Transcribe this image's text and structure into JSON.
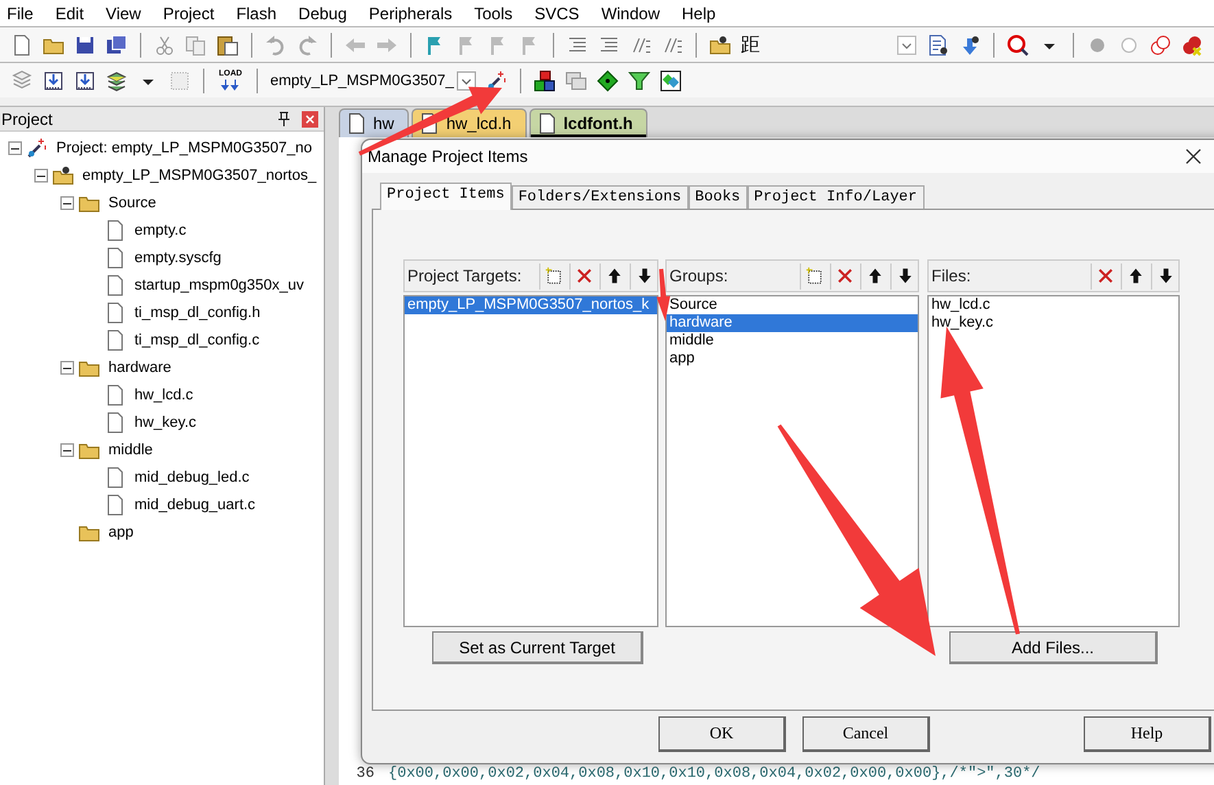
{
  "menu": [
    "File",
    "Edit",
    "View",
    "Project",
    "Flash",
    "Debug",
    "Peripherals",
    "Tools",
    "SVCS",
    "Window",
    "Help"
  ],
  "toolbar_glyph": "距",
  "load_label": "LOAD",
  "target_select": {
    "value": "empty_LP_MSPM0G3507_"
  },
  "project_panel": {
    "title": "Project",
    "tree": [
      {
        "kind": "project",
        "label": "Project: empty_LP_MSPM0G3507_no",
        "expanded": true,
        "children": [
          {
            "kind": "target",
            "label": "empty_LP_MSPM0G3507_nortos_",
            "expanded": true,
            "children": [
              {
                "kind": "group",
                "label": "Source",
                "expanded": true,
                "children": [
                  {
                    "kind": "file",
                    "label": "empty.c"
                  },
                  {
                    "kind": "file",
                    "label": "empty.syscfg"
                  },
                  {
                    "kind": "file",
                    "label": "startup_mspm0g350x_uv"
                  },
                  {
                    "kind": "file",
                    "label": "ti_msp_dl_config.h"
                  },
                  {
                    "kind": "file",
                    "label": "ti_msp_dl_config.c"
                  }
                ]
              },
              {
                "kind": "group",
                "label": "hardware",
                "expanded": true,
                "children": [
                  {
                    "kind": "file",
                    "label": "hw_lcd.c"
                  },
                  {
                    "kind": "file",
                    "label": "hw_key.c"
                  }
                ]
              },
              {
                "kind": "group",
                "label": "middle",
                "expanded": true,
                "children": [
                  {
                    "kind": "file",
                    "label": "mid_debug_led.c"
                  },
                  {
                    "kind": "file",
                    "label": "mid_debug_uart.c"
                  }
                ]
              },
              {
                "kind": "group",
                "label": "app"
              }
            ]
          }
        ]
      }
    ]
  },
  "editor": {
    "tabs": [
      {
        "label": "hw",
        "color": "#c7d2e4",
        "selected": false
      },
      {
        "label": "hw_lcd.h",
        "color": "#f3cf73",
        "selected": false
      },
      {
        "label": "lcdfont.h",
        "color": "#c6d6a4",
        "selected": true
      }
    ],
    "code_lines": [
      {
        "number": "36",
        "text": "{0x00,0x00,0x02,0x04,0x08,0x10,0x10,0x08,0x04,0x02,0x00,0x00},/*\">\",30*/"
      }
    ]
  },
  "dialog": {
    "title": "Manage Project Items",
    "tabs": [
      {
        "label": "Project Items",
        "selected": true
      },
      {
        "label": "Folders/Extensions",
        "selected": false
      },
      {
        "label": "Books",
        "selected": false
      },
      {
        "label": "Project Info/Layer",
        "selected": false
      }
    ],
    "panes": [
      {
        "kind": "targets",
        "label": "Project Targets:",
        "items": [
          {
            "label": "empty_LP_MSPM0G3507_nortos_k",
            "selected": true
          }
        ],
        "button": "Set as Current Target"
      },
      {
        "kind": "groups",
        "label": "Groups:",
        "items": [
          {
            "label": "Source",
            "selected": false
          },
          {
            "label": "hardware",
            "selected": true
          },
          {
            "label": "middle",
            "selected": false
          },
          {
            "label": "app",
            "selected": false
          }
        ]
      },
      {
        "kind": "files",
        "label": "Files:",
        "items": [
          {
            "label": "hw_lcd.c",
            "selected": false
          },
          {
            "label": "hw_key.c",
            "selected": false
          }
        ],
        "button": "Add Files..."
      }
    ],
    "buttons": [
      "OK",
      "Cancel",
      "Help"
    ]
  }
}
